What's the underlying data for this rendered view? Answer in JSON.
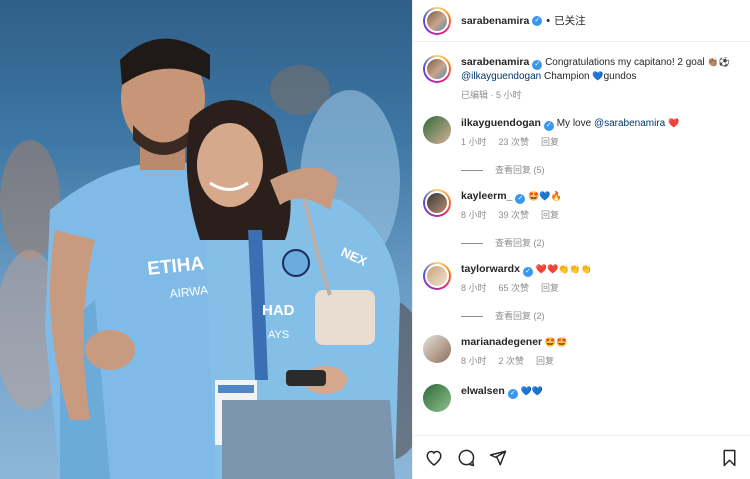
{
  "post": {
    "author": "sarabenamira",
    "follow_state": "已关注",
    "separator": "•"
  },
  "caption": {
    "username": "sarabenamira",
    "text_part1": "Congratulations my capitano! 2 goal",
    "emoji_part1": "👏🏽⚽",
    "mention": "@ilkayguendogan",
    "text_part2": " Champion ",
    "emoji_part2": "💙",
    "text_part3": "gundos",
    "meta": "已编辑 · 5 小时"
  },
  "comments": [
    {
      "username": "ilkayguendogan",
      "verified": true,
      "text": "My love ",
      "mention": "@sarabenamira",
      "emoji": "❤️",
      "time": "1 小时",
      "likes": "23 次赞",
      "reply": "回复",
      "view_replies": "查看回复 (5)"
    },
    {
      "username": "kayleerm_",
      "verified": true,
      "text": "",
      "mention": "",
      "emoji": "🤩💙🔥",
      "time": "8 小时",
      "likes": "39 次赞",
      "reply": "回复",
      "view_replies": "查看回复 (2)"
    },
    {
      "username": "taylorwardx",
      "verified": true,
      "text": "",
      "mention": "",
      "emoji": "❤️❤️👏👏👏",
      "time": "8 小时",
      "likes": "65 次赞",
      "reply": "回复",
      "view_replies": "查看回复 (2)"
    },
    {
      "username": "marianadegener",
      "verified": false,
      "text": "",
      "mention": "",
      "emoji": "🤩🤩",
      "time": "8 小时",
      "likes": "2 次赞",
      "reply": "回复",
      "view_replies": ""
    }
  ],
  "partial_comment": {
    "username": "elwalsen",
    "emoji": "💙💙"
  },
  "icons": [
    "heart-icon",
    "comment-icon",
    "share-icon",
    "bookmark-icon"
  ],
  "colors": {
    "link": "#00376b",
    "verified": "#3897f0",
    "meta": "#8e8e8e",
    "kit_blue": "#6cabdd"
  }
}
